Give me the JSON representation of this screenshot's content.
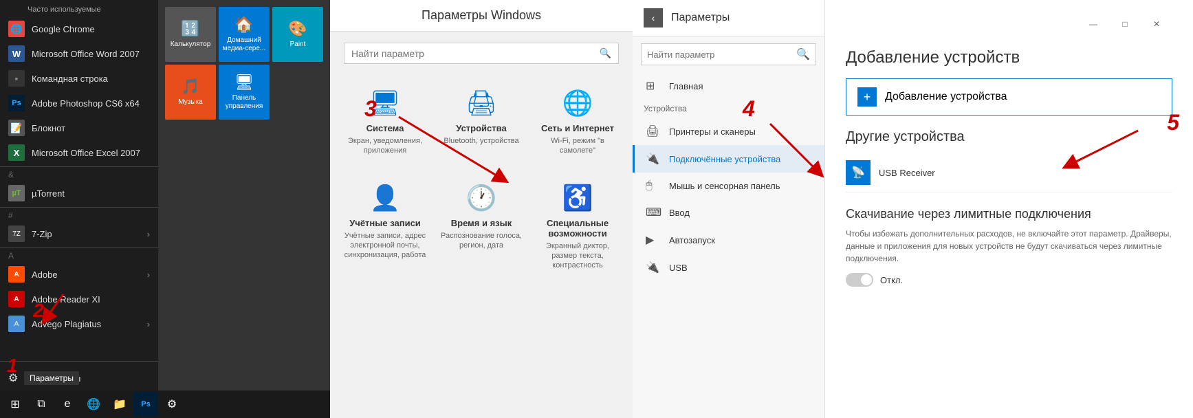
{
  "startMenu": {
    "frequentLabel": "Часто используемые",
    "apps": [
      {
        "name": "Google Chrome",
        "iconColor": "#e8453c",
        "iconText": "🌐"
      },
      {
        "name": "Microsoft Office Word 2007",
        "iconColor": "#2b5797",
        "iconText": "W"
      },
      {
        "name": "Командная строка",
        "iconColor": "#333",
        "iconText": "▪"
      },
      {
        "name": "Adobe Photoshop CS6 x64",
        "iconColor": "#001e36",
        "iconText": "Ps"
      },
      {
        "name": "Блокнот",
        "iconColor": "#555",
        "iconText": "📝"
      },
      {
        "name": "Microsoft Office Excel 2007",
        "iconColor": "#1e6f3d",
        "iconText": "X"
      }
    ],
    "sections": {
      "ampersand": "&",
      "hash": "#",
      "letterA": "A"
    },
    "sectionApps": {
      "ampersand": [
        {
          "name": "µTorrent",
          "iconColor": "#676767"
        }
      ],
      "hash": [
        {
          "name": "7-Zip",
          "iconColor": "#444",
          "hasArrow": true
        }
      ],
      "a": [
        {
          "name": "Adobe",
          "iconColor": "#ff4b00",
          "hasArrow": true
        },
        {
          "name": "Adobe Reader XI",
          "iconColor": "#cc0000"
        },
        {
          "name": "Advego Plagiatus",
          "iconColor": "#4a90d9",
          "hasArrow": true
        }
      ]
    },
    "bottomItems": [
      {
        "label": "Параметры",
        "icon": "⚙"
      },
      {
        "label": "",
        "icon": "⏻"
      }
    ],
    "settingsTooltip": "Параметры"
  },
  "tiles": [
    {
      "label": "Калькулятор",
      "bg": "#666",
      "icon": "🔢"
    },
    {
      "label": "Домашний медиа-сере...",
      "bg": "#0078d4",
      "icon": "🏠"
    },
    {
      "label": "Paint",
      "bg": "#0099bc",
      "icon": "🎨"
    },
    {
      "label": "Музыка",
      "bg": "#e84d1c",
      "icon": "🎵"
    },
    {
      "label": "Панель управления",
      "bg": "#0078d4",
      "icon": "🖥"
    }
  ],
  "windowsSettings": {
    "title": "Параметры Windows",
    "searchPlaceholder": "Найти параметр",
    "items": [
      {
        "name": "Система",
        "desc": "Экран, уведомления, приложения",
        "icon": "🖥"
      },
      {
        "name": "Устройства",
        "desc": "Bluetooth, устройства",
        "icon": "🖨"
      },
      {
        "name": "Сеть и Интернет",
        "desc": "Wi-Fi, режим \"в самолете\"",
        "icon": "🌐"
      },
      {
        "name": "Учётные записи",
        "desc": "Учётные записи, адрес электронной почты, синхронизация, работа",
        "icon": "👤"
      },
      {
        "name": "Время и язык",
        "desc": "Распознование голоса, регион, дата",
        "icon": "🕐"
      },
      {
        "name": "Специальные возможности",
        "desc": "Экранный диктор, размер текста, контрастность",
        "icon": "♿"
      }
    ],
    "arrow3": "3"
  },
  "paramsPanel": {
    "title": "Параметры",
    "backIcon": "‹",
    "searchPlaceholder": "Найти параметр",
    "mainItem": {
      "label": "Главная",
      "icon": "⊞"
    },
    "sectionTitle": "Устройства",
    "navItems": [
      {
        "label": "Принтеры и сканеры",
        "icon": "🖨",
        "active": false
      },
      {
        "label": "Подключённые устройства",
        "icon": "🔌",
        "active": true
      },
      {
        "label": "Мышь и сенсорная панель",
        "icon": "🖱",
        "active": false
      },
      {
        "label": "Ввод",
        "icon": "⌨",
        "active": false
      },
      {
        "label": "Автозапуск",
        "icon": "▶",
        "active": false
      },
      {
        "label": "USB",
        "icon": "🔌",
        "active": false
      }
    ],
    "arrow4": "4"
  },
  "devicePanel": {
    "windowTitle": "Добавление устройств",
    "addDeviceBtn": "Добавление устройства",
    "otherDevicesTitle": "Другие устройства",
    "devices": [
      {
        "name": "USB Receiver",
        "icon": "📡"
      }
    ],
    "downloadSection": {
      "title": "Скачивание через лимитные подключения",
      "desc": "Чтобы избежать дополнительных расходов, не включайте этот параметр. Драйверы, данные и приложения для новых устройств не будут скачиваться через лимитные подключения.",
      "toggleLabel": "Откл.",
      "toggleState": "off"
    },
    "arrow5": "5",
    "windowControls": {
      "minimize": "—",
      "maximize": "□",
      "close": "✕"
    }
  },
  "annotations": {
    "1": "1",
    "2": "2",
    "3": "3",
    "4": "4",
    "5": "5"
  }
}
